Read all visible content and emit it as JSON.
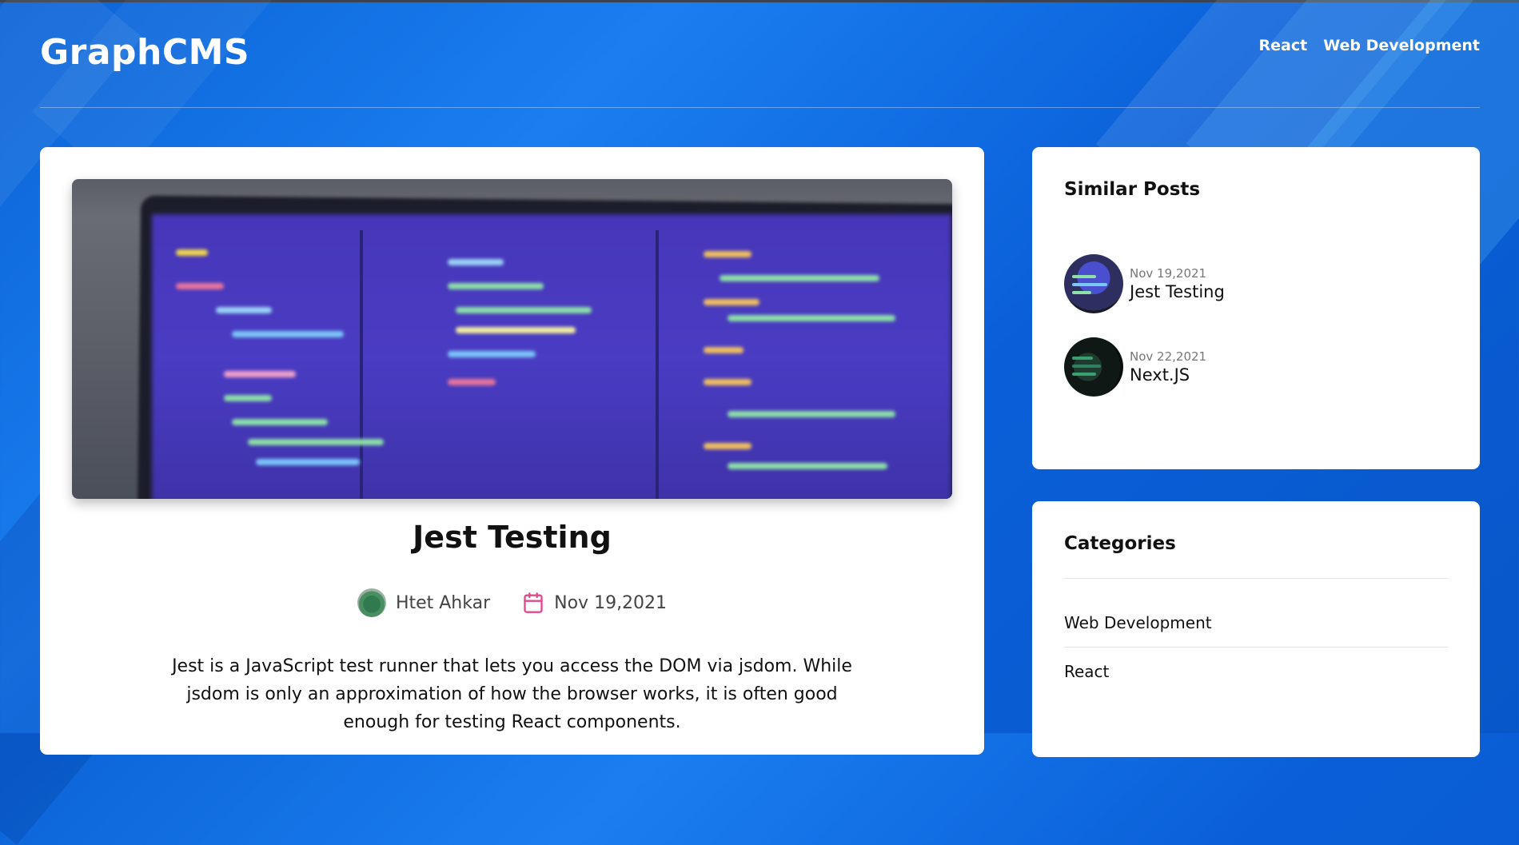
{
  "header": {
    "brand": "GraphCMS",
    "nav": [
      "React",
      "Web Development"
    ]
  },
  "post": {
    "title": "Jest Testing",
    "author": "Htet Ahkar",
    "date": "Nov 19,2021",
    "excerpt": "Jest is a JavaScript test runner that lets you access the DOM via jsdom. While jsdom is only an approximation of how the browser works, it is often good enough for testing React components."
  },
  "similar_posts": {
    "heading": "Similar Posts",
    "items": [
      {
        "date": "Nov 19,2021",
        "title": "Jest Testing"
      },
      {
        "date": "Nov 22,2021",
        "title": "Next.JS"
      }
    ]
  },
  "categories": {
    "heading": "Categories",
    "items": [
      "Web Development",
      "React"
    ]
  },
  "colors": {
    "background": "#0b63d6",
    "card": "#ffffff",
    "calendar_icon": "#e0498e"
  },
  "icons": [
    "calendar-icon"
  ]
}
